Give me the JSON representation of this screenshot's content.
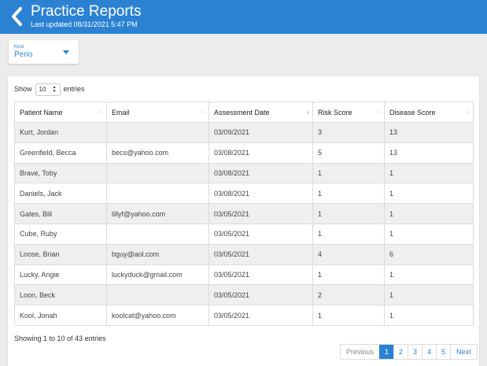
{
  "header": {
    "title": "Practice Reports",
    "subtitle": "Last updated 08/31/2021 5:47 PM",
    "background_color": "#2b82d3"
  },
  "kind": {
    "label": "Kind",
    "value": "Perio"
  },
  "length_menu": {
    "prefix": "Show",
    "value": "10",
    "suffix": "entries"
  },
  "table": {
    "columns": [
      "Patient Name",
      "Email",
      "Assessment Date",
      "Risk Score",
      "Disease Score"
    ],
    "sorted_column": "Assessment Date",
    "sort_direction": "descending",
    "rows": [
      [
        "Kurt, Jordan",
        "",
        "03/09/2021",
        "3",
        "13"
      ],
      [
        "Greenfield, Becca",
        "becs@yahoo.com",
        "03/08/2021",
        "5",
        "13"
      ],
      [
        "Brave, Toby",
        "",
        "03/08/2021",
        "1",
        "1"
      ],
      [
        "Daniels, Jack",
        "",
        "03/08/2021",
        "1",
        "1"
      ],
      [
        "Gates, Bill",
        "lillyf@yahoo.com",
        "03/05/2021",
        "1",
        "1"
      ],
      [
        "Cube, Ruby",
        "",
        "03/05/2021",
        "1",
        "1"
      ],
      [
        "Loose, Brian",
        "bguy@aol.com",
        "03/05/2021",
        "4",
        "6"
      ],
      [
        "Lucky, Angie",
        "luckyduck@gmail.com",
        "03/05/2021",
        "1",
        "1"
      ],
      [
        "Loon, Beck",
        "",
        "03/05/2021",
        "2",
        "1"
      ],
      [
        "Kool, Jonah",
        "koolcat@yahoo.com",
        "03/05/2021",
        "1",
        "1"
      ]
    ]
  },
  "info_text": "Showing 1 to 10 of 43 entries",
  "pagination": {
    "previous": "Previous",
    "pages": [
      "1",
      "2",
      "3",
      "4",
      "5"
    ],
    "current_page": "1",
    "next": "Next"
  }
}
